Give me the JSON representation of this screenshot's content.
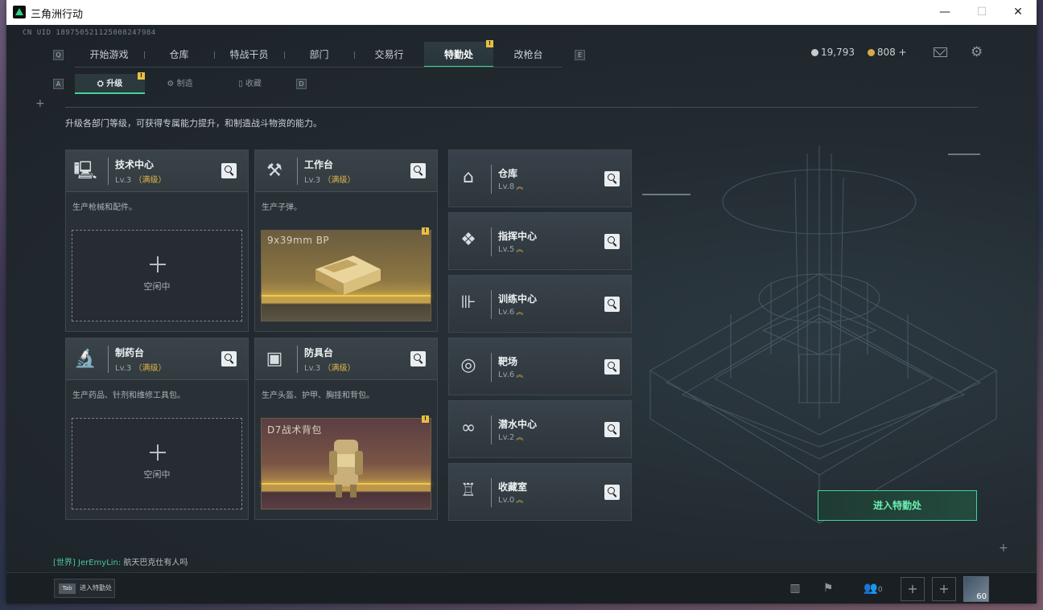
{
  "window": {
    "title": "三角洲行动",
    "minimize": "—",
    "maximize": "☐",
    "close": "✕"
  },
  "uid": "CN UID 1897505211250082479​84",
  "topnav": {
    "left_key": "Q",
    "right_key": "E",
    "items": [
      "开始游戏",
      "仓库",
      "特战干员",
      "部门",
      "交易行",
      "特勤处",
      "改枪台"
    ],
    "active": "特勤处",
    "badge": "!"
  },
  "currency": {
    "coins": "19,793",
    "bonds": "808 +"
  },
  "subnav": {
    "left_key": "A",
    "right_key": "D",
    "items": [
      "升级",
      "制造",
      "收藏"
    ],
    "active": "升级",
    "badge": "!"
  },
  "description": "升级各部门等级，可获得专属能力提升，和制造战斗物资的能力。",
  "workstations": [
    {
      "title": "技术中心",
      "level": "Lv.3",
      "maxed": "（满级）",
      "desc": "生产枪械和配件。",
      "status": "空闲中",
      "icon": "computer-icon"
    },
    {
      "title": "工作台",
      "level": "Lv.3",
      "maxed": "（满级）",
      "desc": "生产子弹。",
      "product": "9x39mm BP",
      "icon": "tools-icon",
      "badge": "!"
    },
    {
      "title": "制药台",
      "level": "Lv.3",
      "maxed": "（满级）",
      "desc": "生产药品、针剂和维修工具包。",
      "status": "空闲中",
      "icon": "microscope-icon"
    },
    {
      "title": "防具台",
      "level": "Lv.3",
      "maxed": "（满级）",
      "desc": "生产头盔、护甲、胸挂和背包。",
      "product": "D7战术背包",
      "icon": "cubes-icon",
      "badge": "!"
    }
  ],
  "facilities": [
    {
      "title": "仓库",
      "level": "Lv.8",
      "icon": "warehouse-icon"
    },
    {
      "title": "指挥中心",
      "level": "Lv.5",
      "icon": "command-icon"
    },
    {
      "title": "训练中心",
      "level": "Lv.6",
      "icon": "dumbbell-icon"
    },
    {
      "title": "靶场",
      "level": "Lv.6",
      "icon": "target-icon"
    },
    {
      "title": "潜水中心",
      "level": "Lv.2",
      "icon": "goggles-icon"
    },
    {
      "title": "收藏室",
      "level": "Lv.0",
      "icon": "trophy-icon"
    }
  ],
  "enter_button": "进入特勤处",
  "chat": {
    "channel": "[世界]",
    "user": "JerEmyLin:",
    "message": "航天巴克仕有人吗"
  },
  "bottom": {
    "tab_key": "Tab",
    "tab_label": "进入特勤处",
    "friends_count": "0",
    "player_level": "60"
  },
  "colors": {
    "accent": "#3ed59a",
    "maxed": "#e0b44a",
    "badge": "#e8c042"
  }
}
